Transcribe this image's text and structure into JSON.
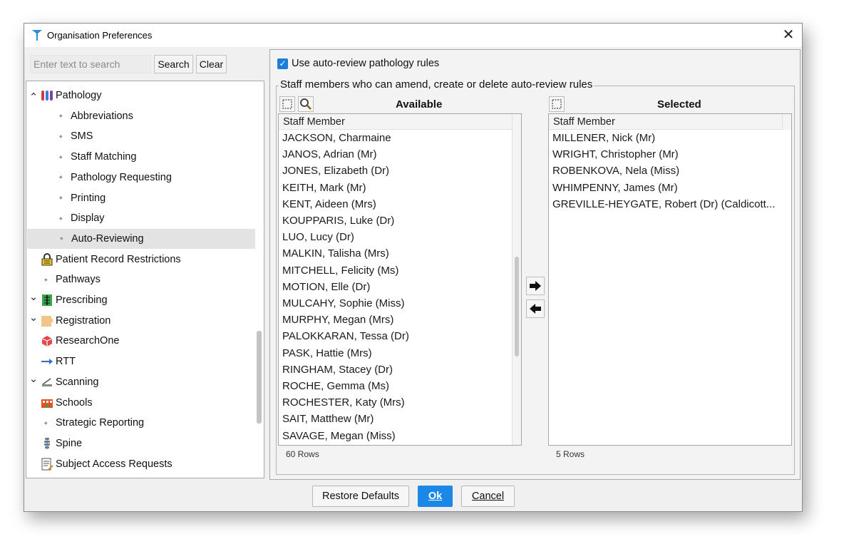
{
  "window": {
    "title": "Organisation Preferences",
    "close_glyph": "✕"
  },
  "search": {
    "placeholder": "Enter text to search",
    "value": "",
    "search_label": "Search",
    "clear_label": "Clear",
    "clear_mnemonic": "l"
  },
  "tree": {
    "items": [
      {
        "label": "Pathology",
        "level": 0,
        "expander": "expanded",
        "icon": "test-tubes-icon"
      },
      {
        "label": "Abbreviations",
        "level": 1,
        "expander": "none",
        "icon": "bullet"
      },
      {
        "label": "SMS",
        "level": 1,
        "expander": "none",
        "icon": "bullet"
      },
      {
        "label": "Staff Matching",
        "level": 1,
        "expander": "none",
        "icon": "bullet"
      },
      {
        "label": "Pathology Requesting",
        "level": 1,
        "expander": "none",
        "icon": "bullet"
      },
      {
        "label": "Printing",
        "level": 1,
        "expander": "none",
        "icon": "bullet"
      },
      {
        "label": "Display",
        "level": 1,
        "expander": "none",
        "icon": "bullet"
      },
      {
        "label": "Auto-Reviewing",
        "level": 1,
        "expander": "none",
        "icon": "bullet",
        "selected": true
      },
      {
        "label": "Patient Record Restrictions",
        "level": 0,
        "expander": "none",
        "icon": "padlock-icon"
      },
      {
        "label": "Pathways",
        "level": 0,
        "expander": "none",
        "icon": "bullet"
      },
      {
        "label": "Prescribing",
        "level": 0,
        "expander": "collapsed",
        "icon": "prescription-icon"
      },
      {
        "label": "Registration",
        "level": 0,
        "expander": "collapsed",
        "icon": "folder-icon"
      },
      {
        "label": "ResearchOne",
        "level": 0,
        "expander": "none",
        "icon": "research-cube-icon"
      },
      {
        "label": "RTT",
        "level": 0,
        "expander": "none",
        "icon": "arrow-right-icon"
      },
      {
        "label": "Scanning",
        "level": 0,
        "expander": "collapsed",
        "icon": "scanner-icon"
      },
      {
        "label": "Schools",
        "level": 0,
        "expander": "none",
        "icon": "school-icon"
      },
      {
        "label": "Strategic Reporting",
        "level": 0,
        "expander": "none",
        "icon": "bullet"
      },
      {
        "label": "Spine",
        "level": 0,
        "expander": "none",
        "icon": "spine-icon"
      },
      {
        "label": "Subject Access Requests",
        "level": 0,
        "expander": "none",
        "icon": "document-icon"
      }
    ]
  },
  "settings": {
    "auto_review_checkbox": {
      "label": "Use auto-review pathology rules",
      "checked": true
    },
    "group_title": "Staff members who can amend, create or delete auto-review rules",
    "available": {
      "title": "Available",
      "column_header": "Staff Member",
      "rows": [
        "JACKSON, Charmaine",
        "JANOS, Adrian (Mr)",
        "JONES, Elizabeth (Dr)",
        "KEITH, Mark (Mr)",
        "KENT, Aideen (Mrs)",
        "KOUPPARIS, Luke (Dr)",
        "LUO, Lucy (Dr)",
        "MALKIN, Talisha (Mrs)",
        "MITCHELL, Felicity (Ms)",
        "MOTION, Elle (Dr)",
        "MULCAHY, Sophie (Miss)",
        "MURPHY, Megan (Mrs)",
        "PALOKKARAN, Tessa (Dr)",
        "PASK, Hattie (Mrs)",
        "RINGHAM, Stacey (Dr)",
        "ROCHE, Gemma (Ms)",
        "ROCHESTER, Katy (Mrs)",
        "SAIT, Matthew (Mr)",
        "SAVAGE, Megan (Miss)"
      ],
      "row_count": "60 Rows"
    },
    "selected": {
      "title": "Selected",
      "column_header": "Staff Member",
      "rows": [
        "MILLENER, Nick (Mr)",
        "WRIGHT, Christopher (Mr)",
        "ROBENKOVA, Nela (Miss)",
        "WHIMPENNY, James (Mr)",
        "GREVILLE-HEYGATE, Robert (Dr) (Caldicott..."
      ],
      "row_count": "5 Rows"
    }
  },
  "footer": {
    "restore_label": "Restore Defaults",
    "ok_label": "Ok",
    "cancel_label": "Cancel"
  },
  "colors": {
    "accent": "#1b87e6",
    "selected_row": "#e3e3e3"
  }
}
